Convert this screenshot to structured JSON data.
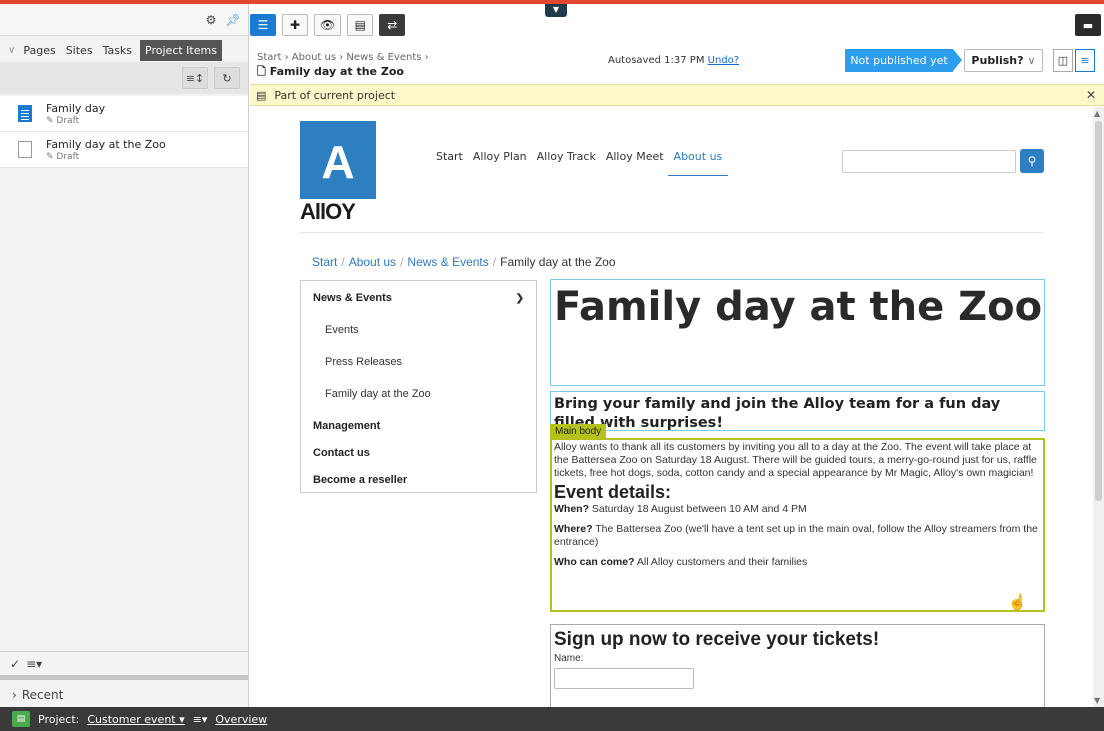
{
  "left_panel": {
    "tabs": [
      {
        "label": "Pages"
      },
      {
        "label": "Sites"
      },
      {
        "label": "Tasks"
      },
      {
        "label": "Project Items"
      }
    ],
    "items": [
      {
        "title": "Family day",
        "status": "Draft",
        "icon": "page-blue-icon"
      },
      {
        "title": "Family day at the Zoo",
        "status": "Draft",
        "icon": "page-blank-icon"
      }
    ],
    "recent_label": "Recent"
  },
  "header": {
    "breadcrumb": "Start › About us › News & Events ›",
    "page_title": "Family day at the Zoo",
    "autosaved": "Autosaved 1:37 PM",
    "undo": "Undo?",
    "status": "Not published yet",
    "publish": "Publish?"
  },
  "notice": {
    "text": "Part of current project"
  },
  "site": {
    "logo_letter": "A",
    "logo_word": "AllOY",
    "nav": [
      "Start",
      "Alloy Plan",
      "Alloy Track",
      "Alloy Meet",
      "About us"
    ],
    "breadcrumb": [
      "Start",
      "About us",
      "News & Events",
      "Family day at the Zoo"
    ],
    "sidenav": {
      "section": "News & Events",
      "children": [
        "Events",
        "Press Releases",
        "Family day at the Zoo"
      ],
      "others": [
        "Management",
        "Contact us",
        "Become a reseller"
      ]
    },
    "title": "Family day at the Zoo",
    "intro": "Bring your family and join the Alloy team for a fun day filled with surprises!",
    "body_tag": "Main body",
    "body_text": "Alloy wants to thank all its customers by inviting you all to a day at the Zoo. The event will take place at the Battersea Zoo on Saturday 18 August. There will be guided tours, a merry-go-round just for us, raffle tickets, free hot dogs, soda, cotton candy and a special appearance by Mr Magic, Alloy's own magician!",
    "details_heading": "Event details:",
    "when_label": "When?",
    "when_value": "Saturday 18 August between 10 AM and 4 PM",
    "where_label": "Where?",
    "where_value": "The Battersea Zoo (we'll have a tent set up in the main oval, follow the Alloy streamers from the entrance)",
    "who_label": "Who can come?",
    "who_value": "All Alloy customers and their families",
    "signup_heading": "Sign up now to receive your tickets!",
    "name_label": "Name:"
  },
  "bottom_bar": {
    "project_label": "Project:",
    "project_name": "Customer event",
    "overview": "Overview"
  },
  "colors": {
    "accent": "#2d9ded",
    "top_stripe": "#e2462f",
    "main_body_highlight": "#b4c21a",
    "brand": "#2d7fc1"
  }
}
